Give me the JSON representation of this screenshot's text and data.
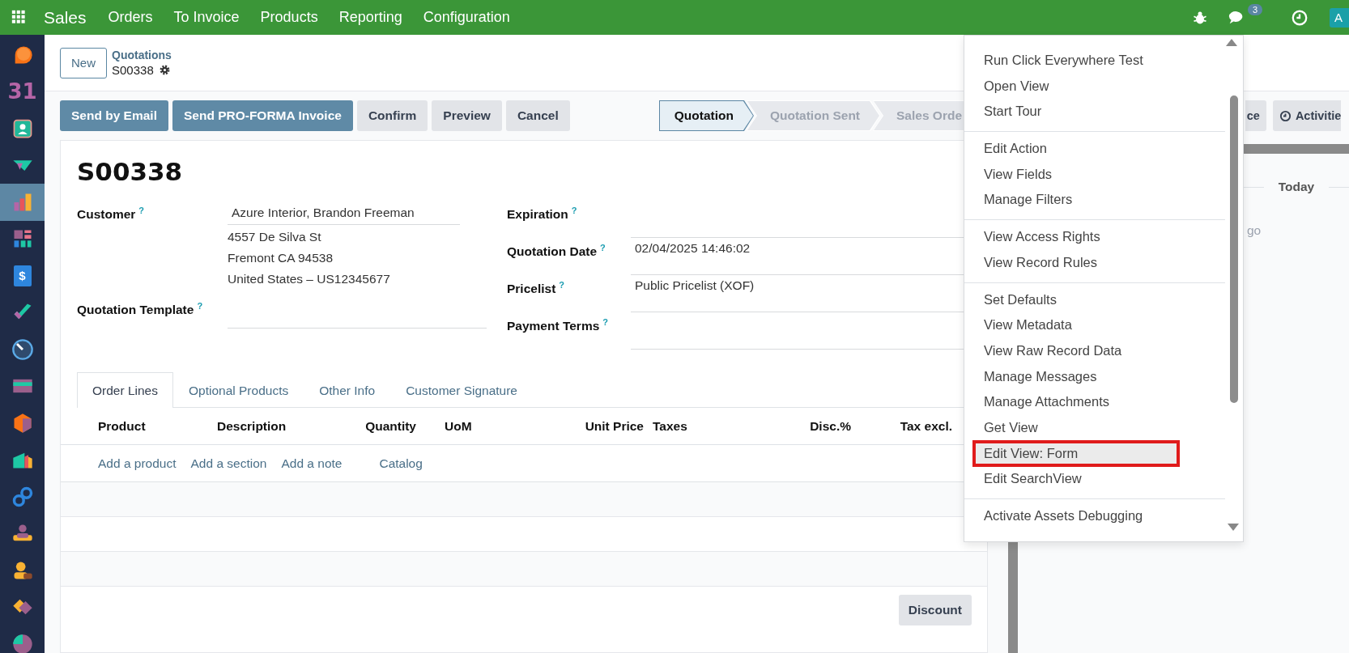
{
  "navbar": {
    "app": "Sales",
    "menus": [
      "Orders",
      "To Invoice",
      "Products",
      "Reporting",
      "Configuration"
    ],
    "message_count": "3",
    "avatar": "A"
  },
  "sidebar": {
    "apps": [
      {
        "kind": "blob",
        "selected": false
      },
      {
        "kind": "calendar",
        "label": "31",
        "selected": false
      },
      {
        "kind": "contact",
        "selected": false
      },
      {
        "kind": "handshake",
        "selected": false
      },
      {
        "kind": "chart",
        "selected": true
      },
      {
        "kind": "grid",
        "selected": false
      },
      {
        "kind": "invoice",
        "label": "$",
        "selected": false
      },
      {
        "kind": "check",
        "selected": false
      },
      {
        "kind": "gauge",
        "selected": false
      },
      {
        "kind": "card",
        "selected": false
      },
      {
        "kind": "cube",
        "selected": false
      },
      {
        "kind": "factory",
        "selected": false
      },
      {
        "kind": "link",
        "selected": false
      },
      {
        "kind": "team",
        "selected": false
      },
      {
        "kind": "person",
        "selected": false
      },
      {
        "kind": "diamonds",
        "selected": false
      },
      {
        "kind": "pie",
        "selected": false
      }
    ]
  },
  "control_panel": {
    "new_button": "New",
    "breadcrumb": "Quotations",
    "record": "S00338"
  },
  "actions": [
    {
      "label": "Send by Email",
      "primary": true
    },
    {
      "label": "Send PRO-FORMA Invoice",
      "primary": true
    },
    {
      "label": "Confirm",
      "primary": false
    },
    {
      "label": "Preview",
      "primary": false
    },
    {
      "label": "Cancel",
      "primary": false
    }
  ],
  "status_bar": [
    {
      "label": "Quotation",
      "selected": true
    },
    {
      "label": "Quotation Sent",
      "selected": false
    },
    {
      "label": "Sales Orde",
      "selected": false
    }
  ],
  "side_buttons": [
    {
      "label": "ce",
      "kind": "plain"
    },
    {
      "label": "Activitie",
      "kind": "activities"
    }
  ],
  "form": {
    "title": "S00338",
    "left_fields": [
      {
        "label": "Customer",
        "help": "?",
        "lines": [
          "Azure Interior, Brandon Freeman",
          "4557 De Silva St",
          "Fremont CA 94538",
          "United States – US12345677"
        ]
      },
      {
        "label": "Quotation Template",
        "help": "?"
      }
    ],
    "right_fields": [
      {
        "label": "Expiration",
        "help": "?"
      },
      {
        "label": "Quotation Date",
        "help": "?",
        "value": "02/04/2025 14:46:02"
      },
      {
        "label": "Pricelist",
        "help": "?",
        "value": "Public Pricelist (XOF)"
      },
      {
        "label": "Payment Terms",
        "help": "?"
      }
    ],
    "tabs": [
      {
        "label": "Order Lines",
        "selected": true
      },
      {
        "label": "Optional Products",
        "selected": false
      },
      {
        "label": "Other Info",
        "selected": false
      },
      {
        "label": "Customer Signature",
        "selected": false
      }
    ],
    "columns": [
      "Product",
      "Description",
      "Quantity",
      "UoM",
      "Unit Price",
      "Taxes",
      "Disc.%",
      "Tax excl."
    ],
    "add_links": [
      "Add a product",
      "Add a section",
      "Add a note",
      "Catalog"
    ],
    "discount_button": "Discount"
  },
  "chatter": {
    "day": "Today",
    "note": "go"
  },
  "debug_menu": {
    "groups": [
      [
        {
          "label": "Run Click Everywhere Test",
          "selected": false,
          "outlined": false
        },
        {
          "label": "Open View",
          "selected": false,
          "outlined": false
        },
        {
          "label": "Start Tour",
          "selected": false,
          "outlined": false
        }
      ],
      [
        {
          "label": "Edit Action",
          "selected": false,
          "outlined": false
        },
        {
          "label": "View Fields",
          "selected": false,
          "outlined": false
        },
        {
          "label": "Manage Filters",
          "selected": false,
          "outlined": false
        }
      ],
      [
        {
          "label": "View Access Rights",
          "selected": false,
          "outlined": false
        },
        {
          "label": "View Record Rules",
          "selected": false,
          "outlined": false
        }
      ],
      [
        {
          "label": "Set Defaults",
          "selected": false,
          "outlined": false
        },
        {
          "label": "View Metadata",
          "selected": false,
          "outlined": false
        },
        {
          "label": "View Raw Record Data",
          "selected": false,
          "outlined": false
        },
        {
          "label": "Manage Messages",
          "selected": false,
          "outlined": false
        },
        {
          "label": "Manage Attachments",
          "selected": false,
          "outlined": false
        },
        {
          "label": "Get View",
          "selected": false,
          "outlined": false
        },
        {
          "label": "Edit View: Form",
          "selected": true,
          "outlined": true
        },
        {
          "label": "Edit SearchView",
          "selected": false,
          "outlined": false
        }
      ],
      [
        {
          "label": "Activate Assets Debugging",
          "selected": false,
          "outlined": false
        }
      ]
    ]
  }
}
